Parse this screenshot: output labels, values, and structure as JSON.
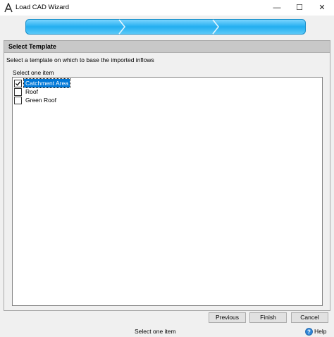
{
  "window": {
    "title": "Load CAD Wizard",
    "minimize": "—",
    "maximize": "☐",
    "close": "✕"
  },
  "wizard": {
    "steps": 3,
    "current_step": 1,
    "accent": "#1fa9e6"
  },
  "panel": {
    "title": "Select Template",
    "instructions": "Select a template on which to base the imported inflows",
    "list_label": "Select one item",
    "items": [
      {
        "label": "Catchment Area",
        "checked": true,
        "selected": true
      },
      {
        "label": "Roof",
        "checked": false,
        "selected": false
      },
      {
        "label": "Green Roof",
        "checked": false,
        "selected": false
      }
    ]
  },
  "buttons": {
    "previous": "Previous",
    "finish": "Finish",
    "cancel": "Cancel"
  },
  "status": {
    "text": "Select one item",
    "help": "Help"
  }
}
